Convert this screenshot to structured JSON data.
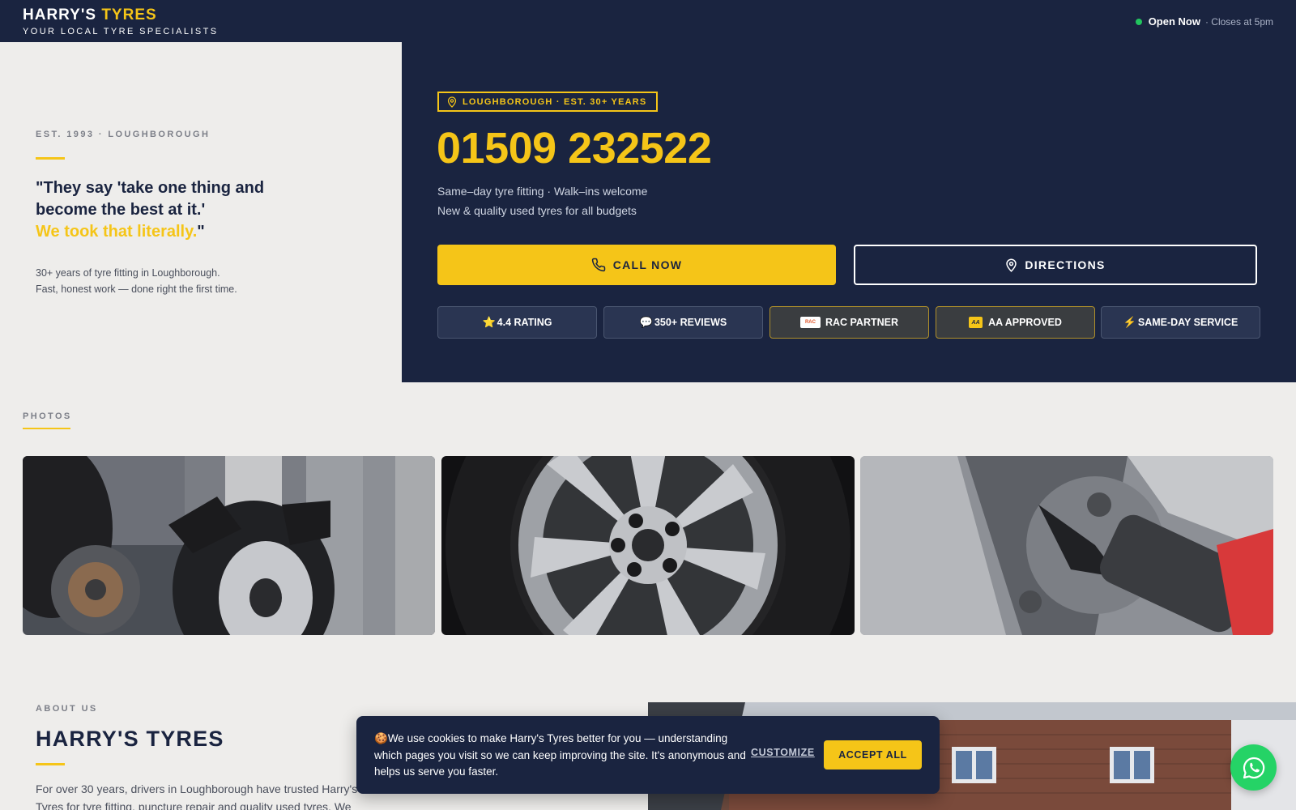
{
  "header": {
    "brand_main": "HARRY'S",
    "brand_accent": "TYRES",
    "tagline": "YOUR LOCAL TYRE SPECIALISTS",
    "open_label": "Open Now",
    "open_detail": "· Closes at 5pm"
  },
  "hero_left": {
    "est": "EST. 1993 · LOUGHBOROUGH",
    "quote_part1": "\"They say 'take one thing and become the best at it.'",
    "quote_highlight": "We took that literally.",
    "quote_end": "\"",
    "desc_line1": "30+ years of tyre fitting in Loughborough.",
    "desc_line2": "Fast, honest work — done right the first time."
  },
  "hero_right": {
    "location_badge": "LOUGHBOROUGH · EST. 30+ YEARS",
    "phone": "01509 232522",
    "sub1": "Same–day tyre fitting · Walk–ins welcome",
    "sub2": "New & quality used tyres for all budgets",
    "call_label": "CALL NOW",
    "directions_label": "DIRECTIONS",
    "badges": [
      {
        "icon": "⭐",
        "label": "4.4 RATING"
      },
      {
        "icon": "💬",
        "label": "350+ REVIEWS"
      },
      {
        "icon": "RAC",
        "label": "RAC PARTNER"
      },
      {
        "icon": "AA",
        "label": "AA APPROVED"
      },
      {
        "icon": "⚡",
        "label": "SAME-DAY SERVICE"
      }
    ]
  },
  "photos": {
    "label": "PHOTOS",
    "images": [
      "mechanic-fitting-tyre",
      "alloy-wheel-closeup",
      "impact-wrench-on-wheel-nut"
    ]
  },
  "about": {
    "label": "ABOUT US",
    "title": "HARRY'S TYRES",
    "text": "For over 30 years, drivers in Loughborough have trusted Harry's Tyres for tyre fitting, puncture repair and quality used tyres. We"
  },
  "cookie": {
    "icon": "🍪",
    "text": "We use cookies to make Harry's Tyres better for you — understanding which pages you visit so we can keep improving the site. It's anonymous and helps us serve you faster.",
    "customize": "CUSTOMIZE",
    "accept": "ACCEPT ALL"
  },
  "colors": {
    "navy": "#1a2440",
    "gold": "#f5c518",
    "bg": "#eeedeb",
    "open_green": "#22c55e",
    "whatsapp": "#25d366"
  }
}
